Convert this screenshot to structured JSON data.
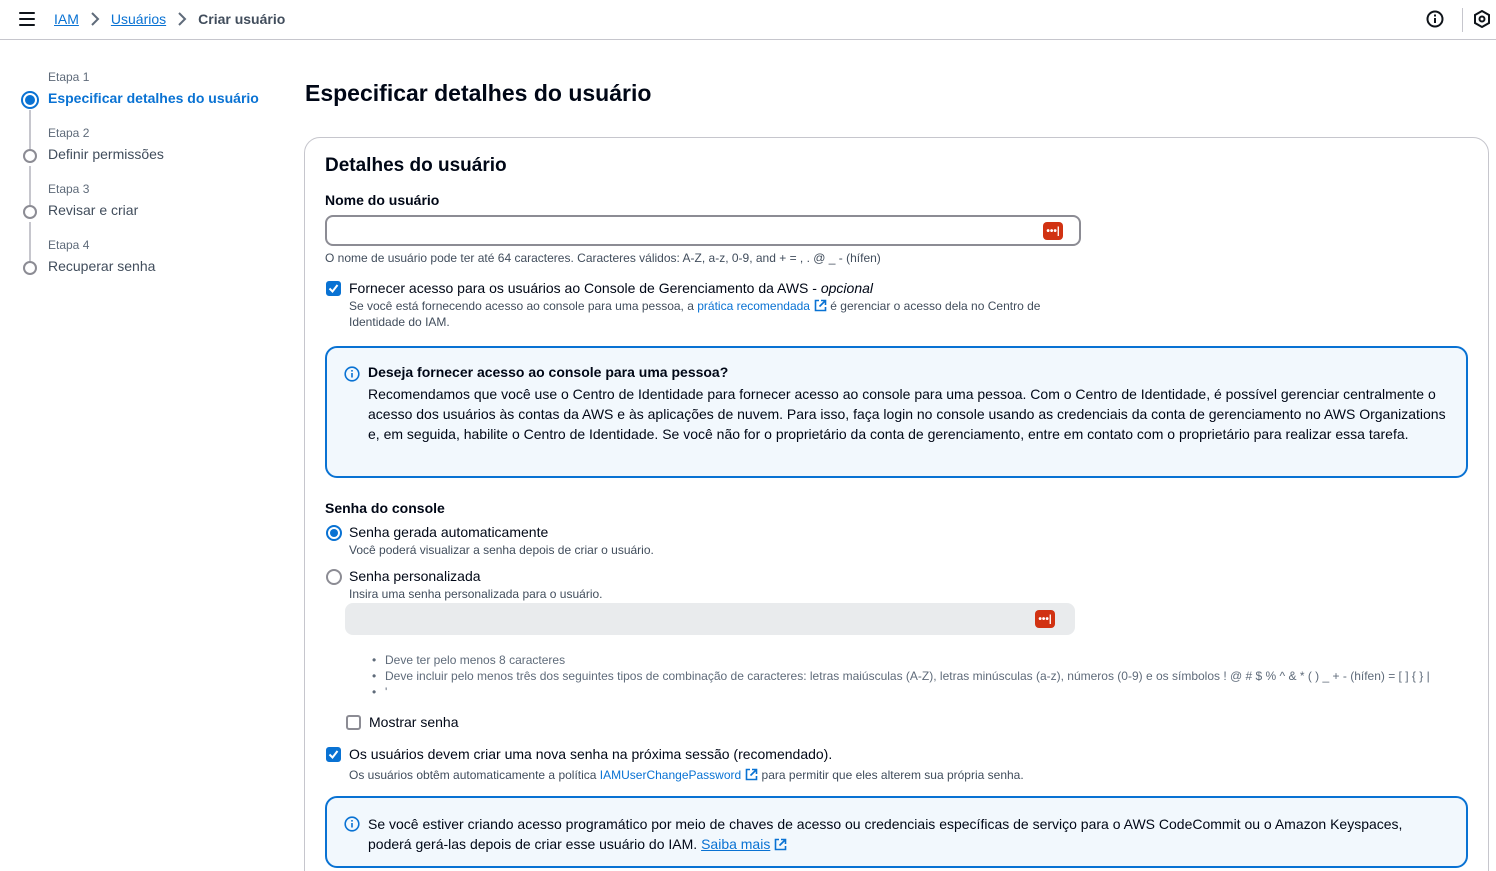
{
  "breadcrumb": {
    "items": [
      "IAM",
      "Usuários"
    ],
    "current": "Criar usuário"
  },
  "steps": [
    {
      "num": "Etapa 1",
      "title": "Especificar detalhes do usuário",
      "active": true
    },
    {
      "num": "Etapa 2",
      "title": "Definir permissões",
      "active": false
    },
    {
      "num": "Etapa 3",
      "title": "Revisar e criar",
      "active": false
    },
    {
      "num": "Etapa 4",
      "title": "Recuperar senha",
      "active": false
    }
  ],
  "page_title": "Especificar detalhes do usuário",
  "panel": {
    "title": "Detalhes do usuário",
    "username_label": "Nome do usuário",
    "username_value": "",
    "username_hint": "O nome de usuário pode ter até 64 caracteres. Caracteres válidos: A-Z, a-z, 0-9, and + = , . @ _ - (hífen)",
    "console_access": {
      "checked": true,
      "label": "Fornecer acesso para os usuários ao Console de Gerenciamento da AWS - ",
      "optional": "opcional",
      "desc_before": "Se você está fornecendo acesso ao console para uma pessoa, a ",
      "desc_link": "prática recomendada",
      "desc_after": " é gerenciar o acesso dela no Centro de",
      "desc_line2": "Identidade do IAM."
    },
    "info_alert": {
      "heading": "Deseja fornecer acesso ao console para uma pessoa?",
      "body": "Recomendamos que você use o Centro de Identidade para fornecer acesso ao console para uma pessoa. Com o Centro de Identidade, é possível gerenciar centralmente o acesso dos usuários às contas da AWS e às aplicações de nuvem. Para isso, faça login no console usando as credenciais da conta de gerenciamento no AWS Organizations e, em seguida, habilite o Centro de Identidade. Se você não for o proprietário da conta de gerenciamento, entre em contato com o proprietário para realizar essa tarefa."
    },
    "password_section": {
      "label": "Senha do console",
      "auto": {
        "label": "Senha gerada automaticamente",
        "desc": "Você poderá visualizar a senha depois de criar o usuário.",
        "selected": true
      },
      "custom": {
        "label": "Senha personalizada",
        "desc": "Insira uma senha personalizada para o usuário.",
        "selected": false
      },
      "custom_value": "",
      "rules": [
        "Deve ter pelo menos 8 caracteres",
        "Deve incluir pelo menos três dos seguintes tipos de combinação de caracteres: letras maiúsculas (A-Z), letras minúsculas (a-z), números (0-9) e os símbolos ! @ # $ % ^ & * ( ) _ + - (hífen) = [ ] { } |",
        "'"
      ],
      "show_password": {
        "label": "Mostrar senha",
        "checked": false
      },
      "reset_required": {
        "label": "Os usuários devem criar uma nova senha na próxima sessão (recomendado).",
        "checked": true,
        "desc_before": "Os usuários obtêm automaticamente a política ",
        "desc_link": "IAMUserChangePassword",
        "desc_after": " para permitir que eles alterem sua própria senha."
      }
    },
    "programmatic_alert": {
      "line1": "Se você estiver criando acesso programático por meio de chaves de acesso ou credenciais específicas de serviço para o AWS CodeCommit ou o Amazon Keyspaces,",
      "line2": "poderá gerá-las depois de criar esse usuário do IAM. ",
      "link": "Saiba mais"
    }
  },
  "colors": {
    "accent": "#0972d3",
    "alert_bg": "#f2f8fd",
    "password_icon": "#d13212"
  },
  "icons": [
    "menu-icon",
    "chevron-right-icon",
    "info-icon",
    "settings-icon",
    "password-manager-icon",
    "external-link-icon",
    "check-icon"
  ]
}
